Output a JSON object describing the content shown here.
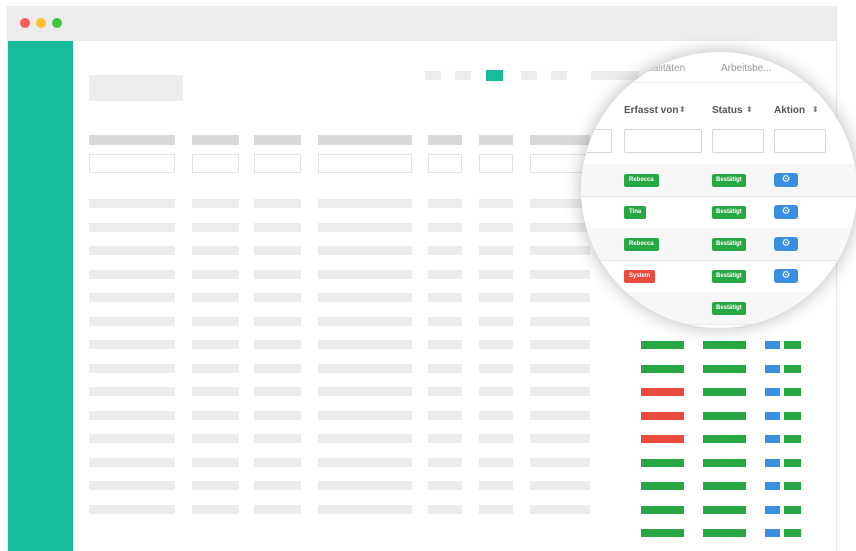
{
  "colors": {
    "sidebar": "#19bc9a",
    "accent": "#19bc9a",
    "success": "#27a844",
    "danger": "#e84c3d",
    "info": "#3b8fe0",
    "titlebar": "#ececec"
  },
  "window_controls": [
    "close",
    "minimize",
    "maximize"
  ],
  "magnifier": {
    "tabs": [
      "...ualitäten",
      "Arbeitsbe..."
    ],
    "columns": [
      "Erfasst von",
      "Status",
      "Aktion"
    ],
    "sort_icon": "sort-icon",
    "rows": [
      {
        "erfasst_von": "Rebecca",
        "erfasst_color": "success",
        "status": "Bestätigt",
        "action_icon": "gear-icon"
      },
      {
        "erfasst_von": "Tina",
        "erfasst_color": "success",
        "status": "Bestätigt",
        "action_icon": "gear-icon"
      },
      {
        "erfasst_von": "Rebecca",
        "erfasst_color": "success",
        "status": "Bestätigt",
        "action_icon": "gear-icon"
      },
      {
        "erfasst_von": "System",
        "erfasst_color": "danger",
        "status": "Bestätigt",
        "action_icon": "gear-icon"
      },
      {
        "erfasst_von": "",
        "erfasst_color": "danger",
        "status": "Bestätigt",
        "action_icon": ""
      }
    ]
  },
  "background_rows_status": [
    "success",
    "success",
    "danger",
    "danger",
    "danger",
    "success",
    "success",
    "success",
    "success",
    "success"
  ]
}
